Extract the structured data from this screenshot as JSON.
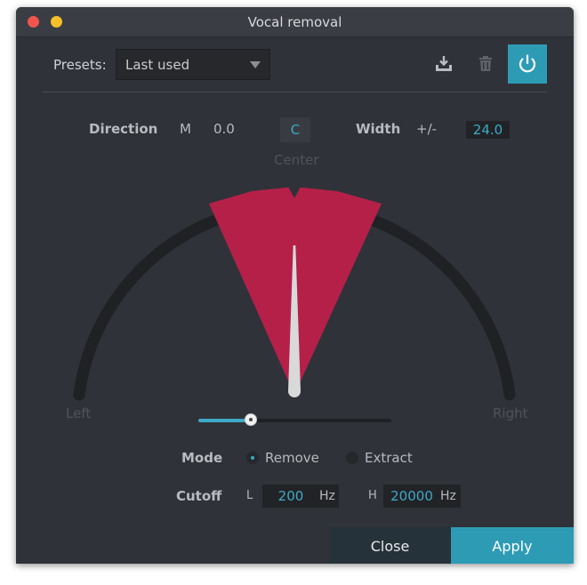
{
  "window": {
    "title": "Vocal removal"
  },
  "toolbar": {
    "presets_label": "Presets:",
    "preset_value": "Last used",
    "save_icon": "download-icon",
    "delete_icon": "trash-icon",
    "power_icon": "power-icon",
    "accent": "#2e9bb5"
  },
  "direction": {
    "label": "Direction",
    "mode_letter": "M",
    "value": "0.0",
    "center_button": "C"
  },
  "width": {
    "label": "Width",
    "plus_minus": "+/-",
    "value": "24.0"
  },
  "dial": {
    "center_label": "Center",
    "left_label": "Left",
    "right_label": "Right",
    "sector_color": "#b52049",
    "needle_color": "#d9d9d9"
  },
  "balance_slider": {
    "value_fraction": 0.27
  },
  "mode": {
    "label": "Mode",
    "options": [
      "Remove",
      "Extract"
    ],
    "selected": "Remove"
  },
  "cutoff": {
    "label": "Cutoff",
    "low_letter": "L",
    "low_value": "200",
    "low_unit": "Hz",
    "high_letter": "H",
    "high_value": "20000",
    "high_unit": "Hz"
  },
  "footer": {
    "close_label": "Close",
    "apply_label": "Apply"
  }
}
